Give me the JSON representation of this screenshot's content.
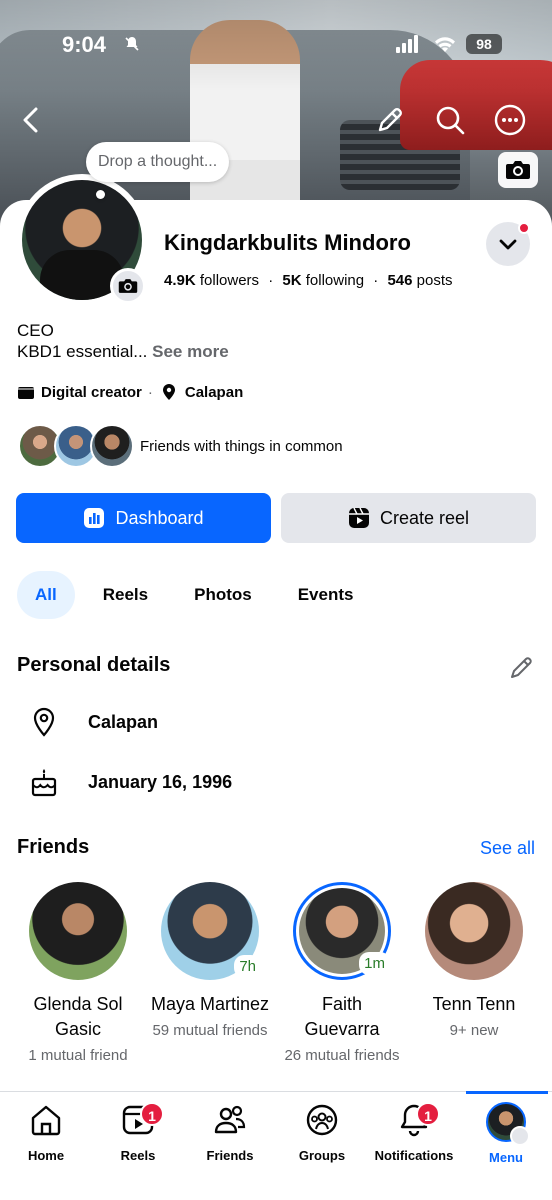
{
  "status_bar": {
    "time": "9:04",
    "battery": "98"
  },
  "cover": {
    "thought_placeholder": "Drop a thought..."
  },
  "profile": {
    "name": "Kingdarkbulits Mindoro",
    "followers_count": "4.9K",
    "followers_label": "followers",
    "following_count": "5K",
    "following_label": "following",
    "posts_count": "546",
    "posts_label": "posts",
    "bio_line1": "CEO",
    "bio_line2": "KBD1 essential...",
    "see_more": "See more",
    "category": "Digital creator",
    "location": "Calapan",
    "common_text": "Friends with things in common"
  },
  "actions": {
    "dashboard": "Dashboard",
    "create_reel": "Create reel"
  },
  "tabs": [
    "All",
    "Reels",
    "Photos",
    "Events"
  ],
  "personal_details": {
    "title": "Personal details",
    "location": "Calapan",
    "birthday": "January 16, 1996"
  },
  "friends": {
    "title": "Friends",
    "see_all": "See all",
    "items": [
      {
        "name": "Glenda Sol Gasic",
        "sub": "1 mutual friend",
        "badge": ""
      },
      {
        "name": "Maya Martinez",
        "sub": "59 mutual friends",
        "badge": "7h"
      },
      {
        "name": "Faith Guevarra",
        "sub": "26 mutual friends",
        "badge": "1m"
      },
      {
        "name": "Tenn Tenn",
        "sub": "9+ new",
        "badge": ""
      }
    ]
  },
  "bottom_nav": {
    "home": "Home",
    "reels": "Reels",
    "reels_badge": "1",
    "friends": "Friends",
    "groups": "Groups",
    "notifications": "Notifications",
    "notifications_badge": "1",
    "menu": "Menu"
  },
  "colors": {
    "accent": "#0866ff",
    "badge_red": "#e41e3f",
    "tab_active_bg": "#e7f3ff"
  }
}
